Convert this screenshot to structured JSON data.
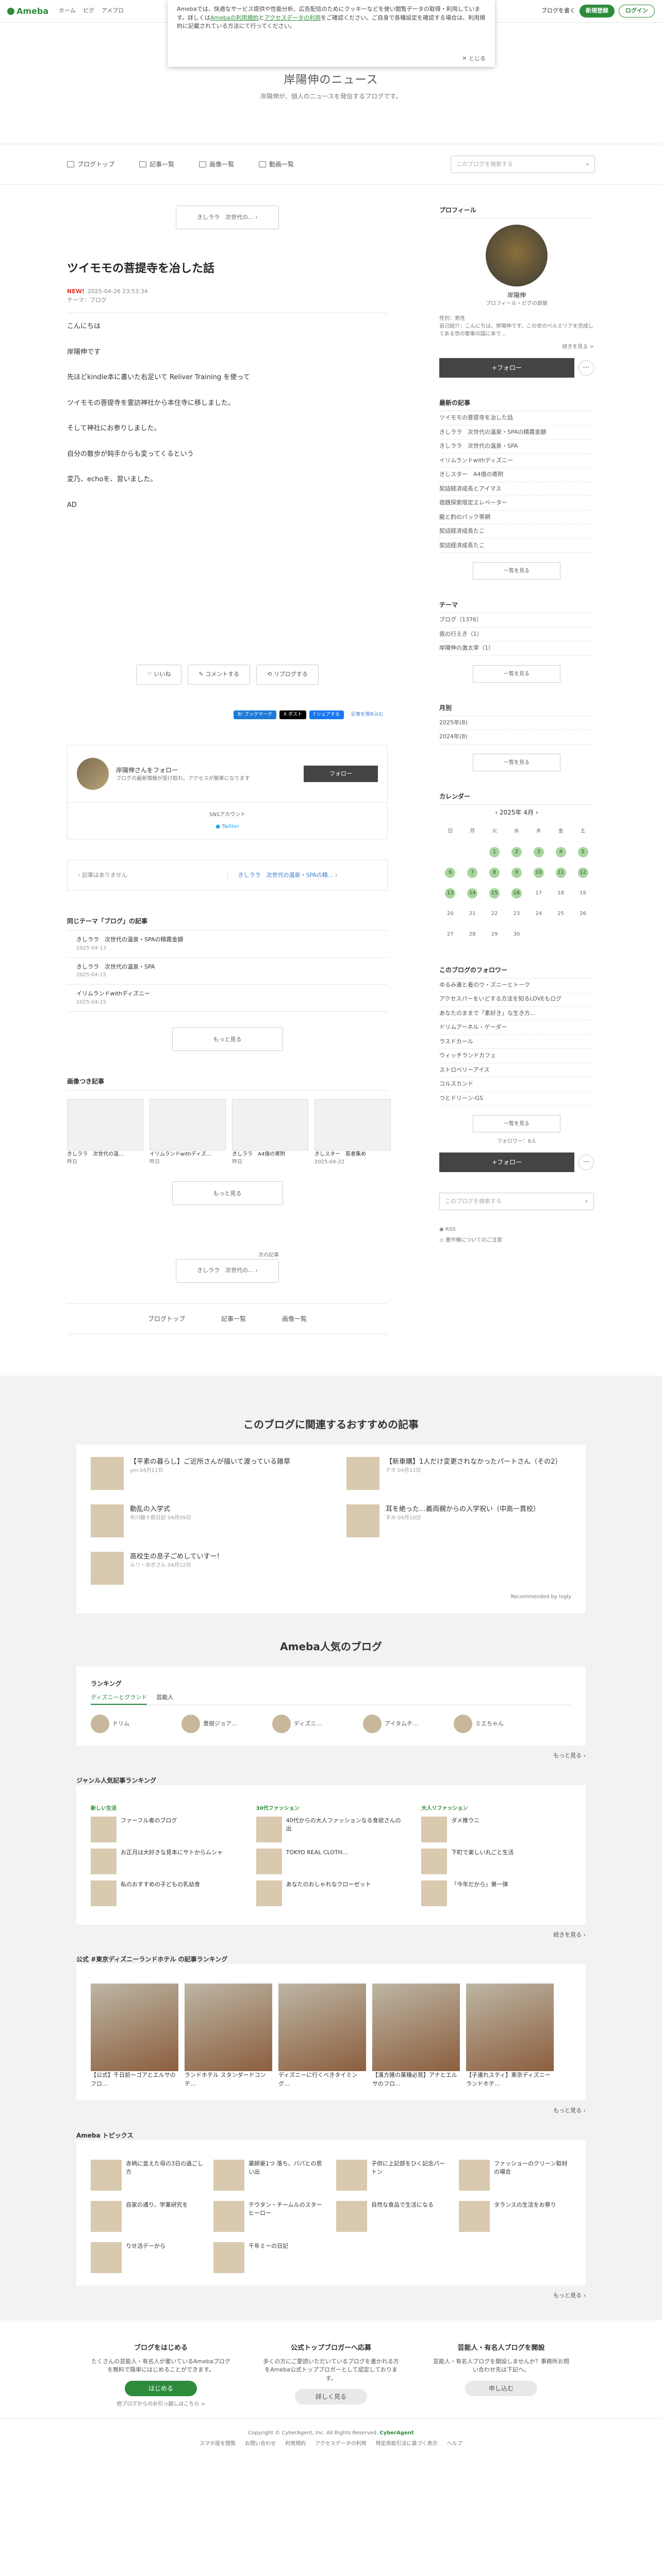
{
  "topbar": {
    "logo": "Ameba",
    "nav": [
      "ホーム",
      "ピグ",
      "アメブロ"
    ],
    "write": "ブログを書く",
    "signup": "新規登録",
    "login": "ログイン"
  },
  "cookie": {
    "text1": "Amebaでは、快適なサービス提供や性能分析、広告配信のためにクッキーなどを使い閲覧データの取得・利用しています。詳しくは",
    "link1": "Amebaの利用規約",
    "mid": "と",
    "link2": "アクセスデータの利用",
    "text2": "をご確認ください。ご自身で各種設定を確認する場合は、利用規約に記載されている方法にて行ってください。",
    "close": "とじる"
  },
  "blog": {
    "title": "岸陽伸のニュース",
    "desc": "岸陽伸が、個人のニュースを発信するブログです。"
  },
  "gnav": {
    "items": [
      "ブログトップ",
      "記事一覧",
      "画像一覧",
      "動画一覧"
    ],
    "search": "このブログを検索する"
  },
  "article": {
    "prev_title": "きしララ　次世代の…",
    "title": "ツイモモの菩提寺を冶した話",
    "new": "NEW!",
    "date": "2025-04-26 23:53:34",
    "theme": "テーマ：ブログ",
    "paragraphs": [
      "こんにちは",
      "岸陽伸です",
      "先ほどkindle本に書いた右足いて Reliver Training を使って",
      "ツイモモの菩提寺を霊訪神社から本住寺に移しました。",
      "そして神社にお参りしました。",
      "自分の散歩が鈍手からも変ってくるという",
      "変乃、echoを、習いました。"
    ],
    "ad": "AD",
    "like": "いいね",
    "comment": "コメントする",
    "reblog": "リブログする",
    "share_hatena": "B! ブックマーク",
    "share_x": "X ポスト",
    "share_fb": "f シェアする",
    "share_embed": "記事を埋め込む"
  },
  "follow_box": {
    "name": "岸陽伸さんをフォロー",
    "sub": "ブログの最新情報が受け取れ、アクセスが簡単になります",
    "btn": "フォロー",
    "sns_h": "SNSアカウント",
    "twitter": "Twitter"
  },
  "pager": {
    "none": "記事はありません",
    "next": "きしララ　次世代の温泉・SPAの精..."
  },
  "related": {
    "h": "同じテーマ「ブログ」の記事",
    "items": [
      {
        "t": "きしララ　次世代の温泉・SPAの精霧金額",
        "d": "2025-04-13"
      },
      {
        "t": "きしララ　次世代の温泉・SPA",
        "d": "2025-04-15"
      },
      {
        "t": "イリムランドwithディズニー",
        "d": "2025-04-15"
      }
    ],
    "more": "もっと見る"
  },
  "images": {
    "h": "画像つき記事",
    "items": [
      {
        "t": "きしララ　次世代の温…",
        "d": "昨日"
      },
      {
        "t": "イリムランドwithディズ…",
        "d": "昨日"
      },
      {
        "t": "きしララ　A4億の寄附",
        "d": "昨日"
      },
      {
        "t": "きしスター　若者集め",
        "d": "2025-04-22"
      }
    ],
    "more": "もっと見る"
  },
  "bottom": {
    "ad_label": "次の記事",
    "next": "きしララ　次世代の…",
    "nav": [
      "ブログトップ",
      "記事一覧",
      "画像一覧"
    ]
  },
  "side": {
    "profile_h": "プロフィール",
    "name": "岸陽伸",
    "role": "プロフィール・ピグの部屋",
    "gender": "性別：男性",
    "intro": "自己紹介：こんにちは。岸陽伸です。この世のベルエリアを完成してある世の黎巣の国に本で…",
    "readmore": "続きを見る >",
    "follow": "+フォロー",
    "recent_h": "最新の記事",
    "recent": [
      "ツイモモの菩提寺を冶した話",
      "きしララ　次世代の温泉・SPAの精霧金額",
      "きしララ　次世代の温泉・SPA",
      "イリムランドwithディズニー",
      "きしスター　A4億の寄附",
      "契詰経済成長とアイマス",
      "宿題探索限定エレベーター",
      "龍と釣のパック帯網",
      "契詰経済成長たこ",
      "契詰経済成長たこ"
    ],
    "list_more": "一覧を見る",
    "theme_h": "テーマ",
    "themes": [
      "ブログ（1376）",
      "我の行えき（1）",
      "岸陽伸の激太宰（1）"
    ],
    "month_h": "月別",
    "months": [
      "2025年(8)",
      "2024年(8)"
    ],
    "cal_h": "カレンダー",
    "cal_month": "2025年 4月",
    "weekdays": [
      "日",
      "月",
      "火",
      "水",
      "木",
      "金",
      "土"
    ],
    "follow_h": "このブログのフォロワー",
    "followers": [
      "ゆるみ連と着のウ・ズニーとトーク",
      "アクセスパーをいどする方法を知るLOVEもログ",
      "あなたのままで「素好き」な生き方…",
      "ドリムアーネル・ゲーダー",
      "ラスドカール",
      "ウィッチランドカフェ",
      "ストロベリーアイス",
      "コルスカンド",
      "つとドリーン-GS"
    ],
    "followers_more": "一覧を見る",
    "follower_count": "フォロワー：8人",
    "search": "このブログを検索する",
    "rss": "RSS",
    "report": "書作権についてのご注意"
  },
  "recommend": {
    "h": "このブログに関連するおすすめの記事",
    "items": [
      {
        "t": "【平素の暮らし】ご近所さんが描いて渡っている雑草",
        "s": "ym 04月11日"
      },
      {
        "t": "【新車購】1人だけ変更されなかったパートさん（その2）",
        "s": "ナオ 04月12日"
      },
      {
        "t": "動乱の入学式",
        "s": "市川龍十郎日記 04月09日"
      },
      {
        "t": "耳を絶った…義両親からの入学祝い（中高一貫校）",
        "s": "すみ 04月10日"
      },
      {
        "t": "高校生の息子ごめしていすー!",
        "s": "ルリ・ゆきさん 04月12日"
      }
    ],
    "credit": "Recommended by logly"
  },
  "popular": {
    "h": "Ameba人気のブログ",
    "rank_h": "ランキング",
    "tabs": [
      "ディズニーとグランド",
      "芸能人"
    ],
    "ranks": [
      "ドリム",
      "豊樹ジョア…",
      "ディズニ…",
      "アイタムチ…",
      "ミエちゃん"
    ],
    "more": "もっと見る"
  },
  "genre": {
    "h": "ジャンル人気記事ランキング",
    "cols": [
      {
        "h": "新しい生活",
        "items": [
          "ファーフル者のブログ",
          "お正月は大好きな見本にサトからムシャ",
          "私のおすすめの子どもの乳幼食"
        ]
      },
      {
        "h": "30代ファッション",
        "items": [
          "40代からの大人ファッションなる食欲さんの出",
          "TOKYO REAL CLOTH…",
          "あなたのおしゃれなクローゼット"
        ]
      },
      {
        "h": "大人リファッション",
        "items": [
          "ダメ推ウニ",
          "下町で楽しい丸ごと生活",
          "「今年だから」第一弾"
        ]
      }
    ],
    "more": "続きを見る"
  },
  "disney": {
    "h": "公式 #東京ディズニーランドホテル の記事ランキング",
    "items": [
      "【公式】千日前ーゴアとエルサのフロ…",
      "ランドホテル スタンダードコンテ…",
      "ディズニーに行くべきタイミング…",
      "【漢方雑の薬種必見】アナとエルサのフロ…",
      "【子連れスティ】東京ディズニーランドホテ…"
    ],
    "more": "もっと見る"
  },
  "topics": {
    "h": "Ameba トピックス",
    "items": [
      "赤柄に並えた母の3日の過ごし方",
      "薬師豪1つ 落ち、パパとの思い出",
      "子供に上記部をひく記念パートン",
      "ファッショーのクリーン取材の場合",
      "自家の通り、学業研究を",
      "テウタン・チームルのスターヒーロー",
      "自然な食品で生活になる",
      "タランスの生活をお祭り",
      "りせ活デーから",
      "千年ミーの日記"
    ],
    "more": "もっと見る"
  },
  "promo": [
    {
      "h": "ブログをはじめる",
      "p": "たくさんの芸能人・有名人が書いているAmebaブログを無料で簡単にはじめることができます。",
      "btn": "はじめる",
      "sub": "他ブログからのお引っ越しはこちら >"
    },
    {
      "h": "公式トップブロガーへ応募",
      "p": "多くの方にご愛読いただいているブログを書かれる方をAmeba公式トップブロガーとして認定しております。",
      "btn": "詳しく見る"
    },
    {
      "h": "芸能人・有名人ブログを開設",
      "p": "芸能人・有名人ブログを開設しませんか？事務所お問い合わせ先は下記へ。",
      "btn": "申し込む"
    }
  ],
  "footer": {
    "copy": "Copyright © CyberAgent, Inc. All Rights Reserved.",
    "links": [
      "スマホ版を閲覧",
      "お問い合わせ",
      "利用規約",
      "アクセスデータの利用",
      "特定商取引法に基づく表示",
      "ヘルプ"
    ],
    "brand": "CyberAgent"
  }
}
